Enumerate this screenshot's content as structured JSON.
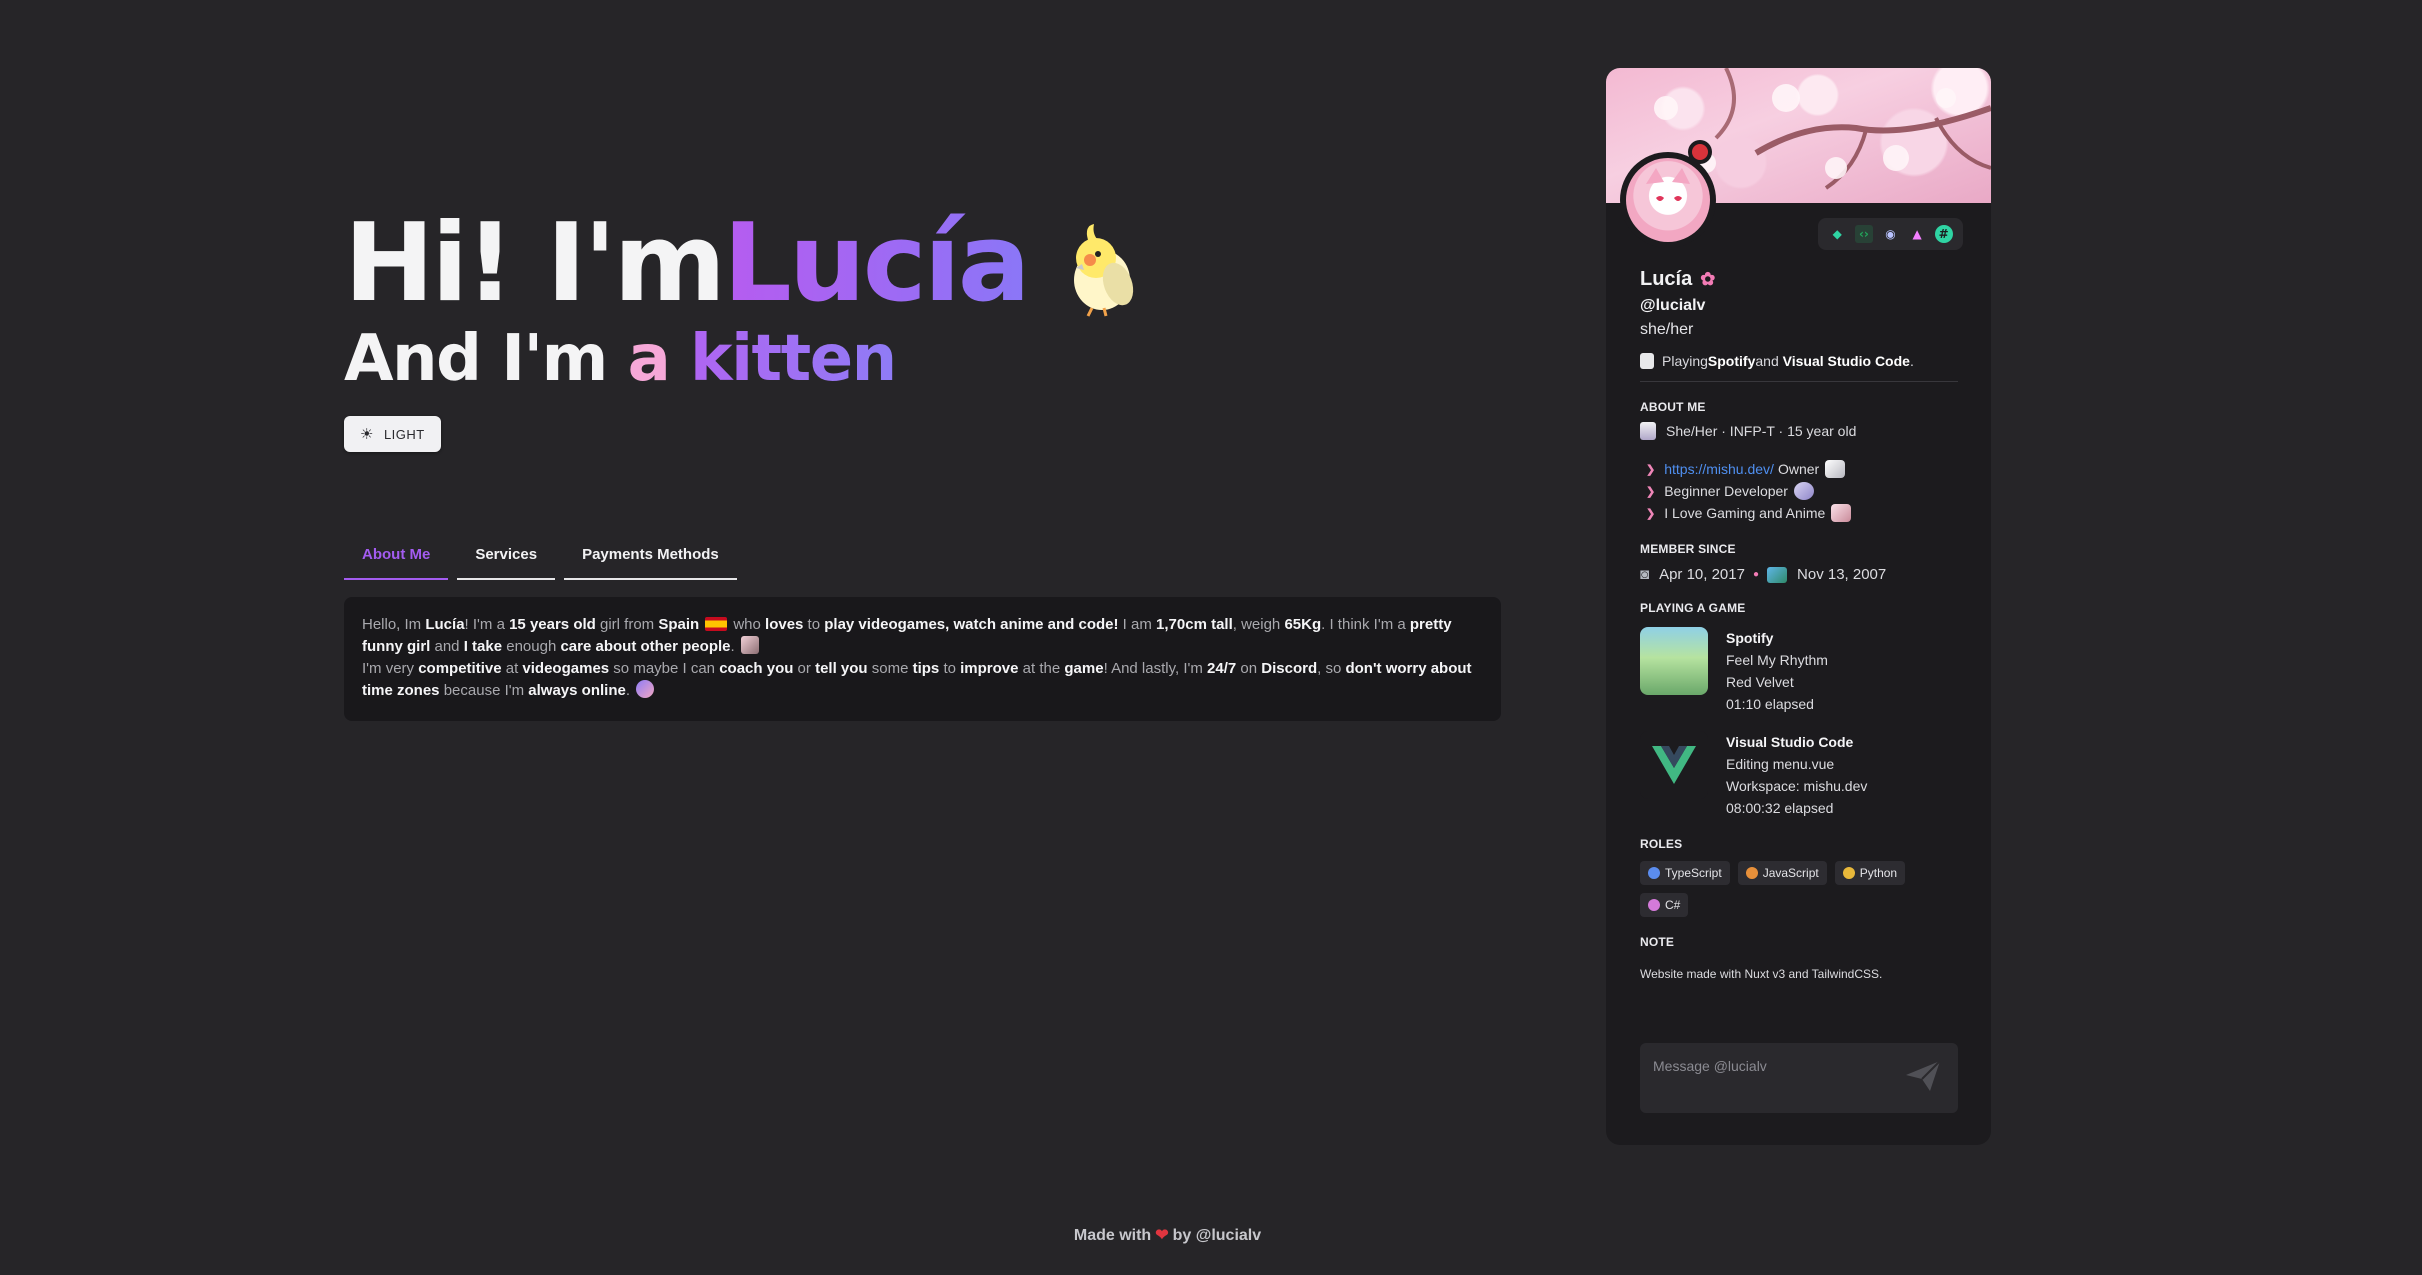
{
  "hero": {
    "hi": "Hi! I'm ",
    "name": "Lucía",
    "and": "And I'm ",
    "a": "a ",
    "kitten": "kitten"
  },
  "theme_toggle": {
    "icon": "sun-icon",
    "label": "LIGHT"
  },
  "tabs": [
    {
      "label": "About Me",
      "active": true
    },
    {
      "label": "Services",
      "active": false
    },
    {
      "label": "Payments Methods",
      "active": false
    }
  ],
  "about": {
    "p1": [
      "Hello, Im ",
      "Lucía",
      "! I'm a ",
      "15 years old",
      " girl from ",
      "Spain",
      " who ",
      "loves",
      " to ",
      "play videogames, watch anime and code!",
      " I am ",
      "1,70cm tall",
      ", weigh ",
      "65Kg",
      ". I think I'm a ",
      "pretty funny girl",
      " and ",
      "I take",
      " enough ",
      "care about other people",
      "."
    ],
    "p2": [
      "I'm very ",
      "competitive",
      " at ",
      "videogames",
      " so maybe I can ",
      "coach you",
      " or ",
      "tell you",
      " some ",
      "tips",
      " to ",
      "improve",
      " at the ",
      "game",
      "! And lastly, I'm ",
      "24/7",
      " on ",
      "Discord",
      ", so ",
      "don't worry about time zones",
      " because I'm ",
      "always online",
      "."
    ]
  },
  "footer": {
    "made_with": "Made with",
    "by": "by @lucialv"
  },
  "profile": {
    "display_name": "Lucía",
    "username": "@lucialv",
    "pronouns": "she/her",
    "activity": {
      "playing": "Playing ",
      "app1": "Spotify",
      "and": " and ",
      "app2": "Visual Studio Code",
      "end": "."
    },
    "about_title": "ABOUT ME",
    "about_line": "She/Her · INFP-T · 15 year old",
    "links": [
      {
        "link": "https://mishu.dev/",
        "text": " Owner"
      },
      {
        "text": "Beginner Developer"
      },
      {
        "text": "I Love Gaming and Anime"
      }
    ],
    "member_since_title": "MEMBER SINCE",
    "discord_date": "Apr 10, 2017",
    "server_date": "Nov 13, 2007",
    "playing_title": "PLAYING A GAME",
    "games": [
      {
        "name": "Spotify",
        "line1": "Feel My Rhythm",
        "line2": "Red Velvet",
        "line3": "01:10 elapsed"
      },
      {
        "name": "Visual Studio Code",
        "line1": "Editing menu.vue",
        "line2": "Workspace: mishu.dev",
        "line3": "08:00:32 elapsed"
      }
    ],
    "roles_title": "ROLES",
    "roles": [
      {
        "name": "TypeScript",
        "color": "#5b8def"
      },
      {
        "name": "JavaScript",
        "color": "#e8903a"
      },
      {
        "name": "Python",
        "color": "#e8b83a"
      },
      {
        "name": "C#",
        "color": "#d47ad9"
      }
    ],
    "note_title": "NOTE",
    "note": "Website made with Nuxt v3 and TailwindCSS.",
    "message_placeholder": "Message @lucialv"
  },
  "colors": {
    "accent": "#a35cf0",
    "background": "#262528",
    "card": "#1c1b1e",
    "status": "#d9333b"
  }
}
